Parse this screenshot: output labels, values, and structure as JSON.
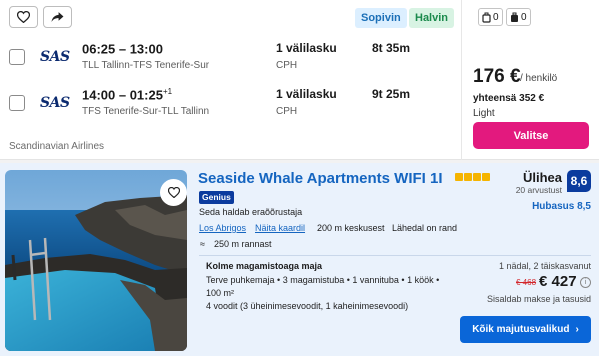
{
  "flight": {
    "tags": {
      "cheapest": "Sopivin",
      "best": "Halvin"
    },
    "airline_logo": "SAS",
    "legs": [
      {
        "time": "06:25 – 13:00",
        "day_offset": "",
        "route": "TLL Tallinn-TFS Tenerife-Sur",
        "stops": "1 välilasku",
        "via": "CPH",
        "duration": "8t 35m"
      },
      {
        "time": "14:00 – 01:25",
        "day_offset": "+1",
        "route": "TFS Tenerife-Sur-TLL Tallinn",
        "stops": "1 välilasku",
        "via": "CPH",
        "duration": "9t 25m"
      }
    ],
    "carrier": "Scandinavian Airlines",
    "bags": {
      "cabin_count": "0",
      "checked_count": "0"
    },
    "price": "176 €",
    "price_unit": "/ henkilö",
    "total": "yhteensä 352 €",
    "fare_type": "Light",
    "select_label": "Valitse"
  },
  "hotel": {
    "name": "Seaside Whale Apartments WIFI 1I",
    "star_count": 4,
    "genius_label": "Genius",
    "host_type": "Seda haldab eraõõrustaja",
    "location": {
      "area": "Los Abrigos",
      "map_link": "Näita kaardil",
      "center_distance": "200 m keskusest",
      "note": "Lähedal on rand"
    },
    "beach_distance": "250 m rannast",
    "rating_word": "Ülihea",
    "review_count": "20 arvustust",
    "score": "8,6",
    "price_rating": "Hubasus 8,5",
    "room": {
      "title": "Kolme magamistoaga maja",
      "lines": [
        "Terve puhkemaja • 3 magamistuba • 1 vannituba • 1 köök •",
        "100 m²",
        "4 voodit (3 üheinimesevoodit, 1 kaheinimesevoodi)"
      ]
    },
    "stay_info": "1 nädal, 2 täiskasvanut",
    "old_price": "€ 468",
    "new_price": "€ 427",
    "taxes_note": "Sisaldab makse ja tasusid",
    "cta_label": "Kõik majutusvalikud"
  }
}
